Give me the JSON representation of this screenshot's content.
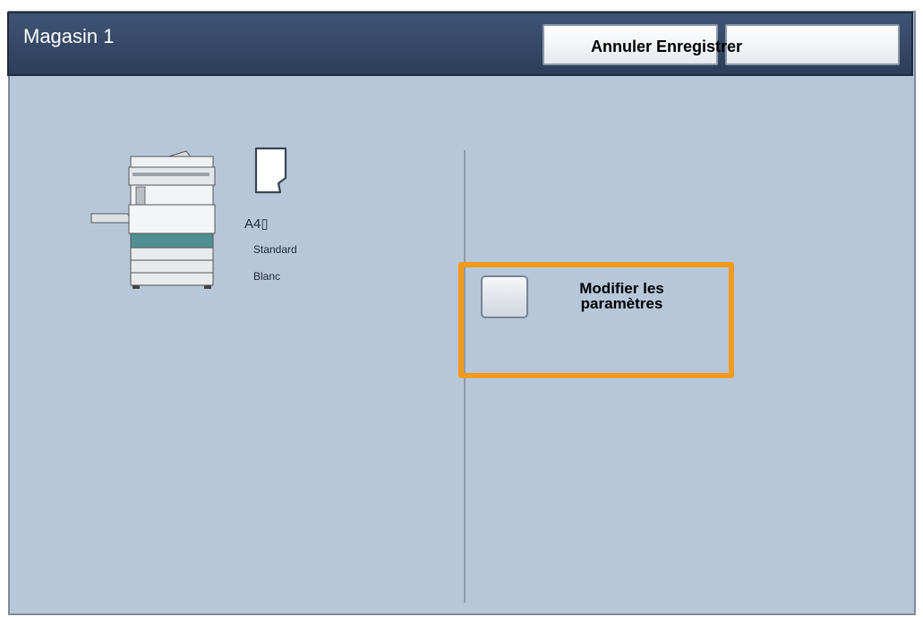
{
  "header": {
    "title": "Magasin 1",
    "button_labels": "Annuler Enregistrer"
  },
  "tray": {
    "paper_size": "A4▯",
    "paper_type": "Standard",
    "paper_color": "Blanc"
  },
  "settings": {
    "modify_label_line1": "Modifier les",
    "modify_label_line2": "paramètres"
  },
  "icons": {
    "printer": "printer-icon",
    "paper": "paper-sheet-icon",
    "checkbox": "checkbox-icon"
  },
  "colors": {
    "panel_bg": "#b7c7da",
    "header_bg": "#2d3e59",
    "highlight": "#f39a1c"
  }
}
